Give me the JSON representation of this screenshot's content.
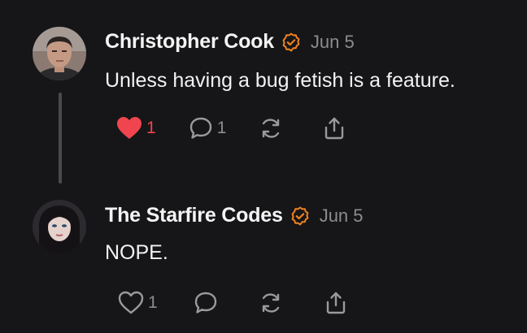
{
  "posts": [
    {
      "author": "Christopher Cook",
      "date": "Jun 5",
      "text": "Unless having a bug fetish is a feature.",
      "likes": "1",
      "liked": true,
      "replies": "1",
      "avatar": "man-portrait-avatar"
    },
    {
      "author": "The Starfire Codes",
      "date": "Jun 5",
      "text": "NOPE.",
      "likes": "1",
      "liked": false,
      "replies": "",
      "avatar": "woman-portrait-avatar"
    }
  ],
  "colors": {
    "background": "#161618",
    "accent_verified": "#f0831f",
    "like_active": "#f0454e",
    "muted": "#8c8c90",
    "thread_line": "#4a4a4d"
  },
  "icons": [
    "verified-badge-icon",
    "heart-icon",
    "reply-icon",
    "repost-icon",
    "share-icon"
  ]
}
